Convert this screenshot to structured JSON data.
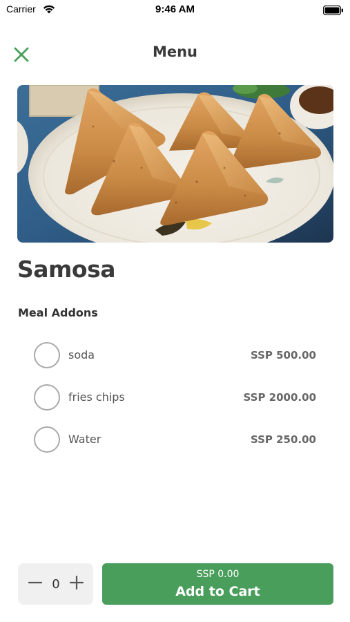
{
  "status_bar": {
    "carrier": "Carrier",
    "time": "9:46 AM",
    "icons": [
      "wifi-icon",
      "battery-icon"
    ]
  },
  "nav": {
    "title": "Menu",
    "close_icon": "close-icon",
    "accent_color": "#4a9e5c"
  },
  "item": {
    "name": "Samosa",
    "image": "samosa-photo"
  },
  "addons": {
    "section_title": "Meal Addons",
    "items": [
      {
        "name": "soda",
        "price": "SSP 500.00",
        "selected": false
      },
      {
        "name": "fries chips",
        "price": "SSP 2000.00",
        "selected": false
      },
      {
        "name": "Water",
        "price": "SSP 250.00",
        "selected": false
      }
    ]
  },
  "cart": {
    "quantity": "0",
    "total": "SSP 0.00",
    "button_label": "Add to Cart",
    "button_color": "#4a9e5c"
  }
}
